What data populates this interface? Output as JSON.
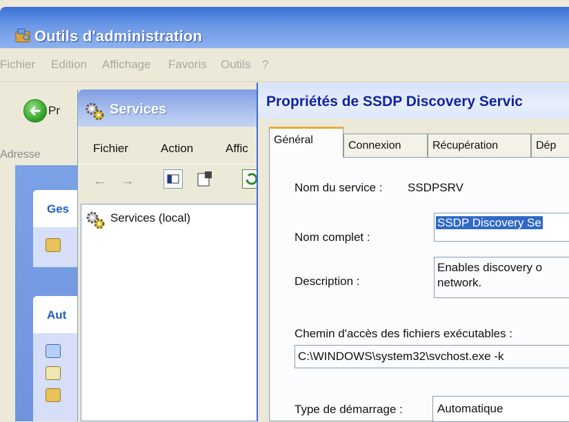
{
  "admin_window": {
    "title": "Outils d'administration",
    "menu": [
      "Fichier",
      "Edition",
      "Affichage",
      "Favoris",
      "Outils",
      "?"
    ],
    "back_label": "Pr",
    "address_label": "Adresse",
    "task_headers": [
      "Ges",
      "Aut"
    ]
  },
  "services_window": {
    "title": "Services",
    "menu": [
      "Fichier",
      "Action",
      "Affic"
    ],
    "tree_item": "Services (local)"
  },
  "dialog": {
    "title": "Propriétés de SSDP Discovery Servic",
    "tabs": [
      "Général",
      "Connexion",
      "Récupération",
      "Dép"
    ],
    "service_name_label": "Nom du service :",
    "service_name_value": "SSDPSRV",
    "full_name_label": "Nom complet :",
    "full_name_value": "SSDP Discovery Se",
    "description_label": "Description :",
    "description_value_line1": "Enables discovery o",
    "description_value_line2": "network.",
    "exe_path_label": "Chemin d'accès des fichiers exécutables :",
    "exe_path_value": "C:\\WINDOWS\\system32\\svchost.exe -k",
    "startup_label": "Type de démarrage :",
    "startup_value": "Automatique"
  },
  "colors": {
    "xp_title_blue": "#3a6fd8",
    "inactive_title": "#a8bfee",
    "dialog_title_text": "#10249e",
    "selection": "#316ac5",
    "tab_highlight": "#e9a93b",
    "task_header_text": "#215dc6"
  },
  "icons": [
    "admin-tools-icon",
    "back-arrow-icon",
    "services-gear-icon",
    "toolbar-back-icon",
    "toolbar-forward-icon",
    "show-hide-tree-icon",
    "properties-icon",
    "refresh-icon",
    "folder-icon"
  ]
}
